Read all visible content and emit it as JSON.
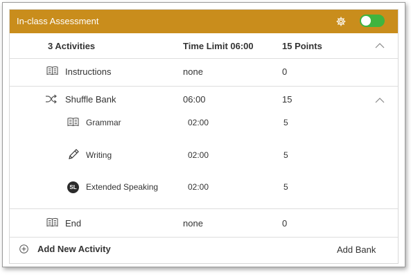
{
  "header": {
    "title": "In-class Assessment",
    "settings_icon": "gear-icon",
    "toggle_on": true,
    "toggle_color": "#3fb43f",
    "background_color": "#c98d1c"
  },
  "summary": {
    "activities": "3 Activities",
    "time_limit": "Time Limit 06:00",
    "points": "15 Points"
  },
  "rows": [
    {
      "name": "Instructions",
      "time": "none",
      "points": "0",
      "icon": "book-icon"
    },
    {
      "name": "Shuffle Bank",
      "time": "06:00",
      "points": "15",
      "icon": "shuffle-icon",
      "children": [
        {
          "name": "Grammar",
          "time": "02:00",
          "points": "5",
          "icon": "book-icon"
        },
        {
          "name": "Writing",
          "time": "02:00",
          "points": "5",
          "icon": "pencil-icon"
        },
        {
          "name": "Extended Speaking",
          "time": "02:00",
          "points": "5",
          "icon": "sl-badge-icon",
          "badge_text": "SL"
        }
      ]
    },
    {
      "name": "End",
      "time": "none",
      "points": "0",
      "icon": "book-icon"
    }
  ],
  "footer": {
    "add_activity": "Add New Activity",
    "add_bank": "Add Bank"
  }
}
